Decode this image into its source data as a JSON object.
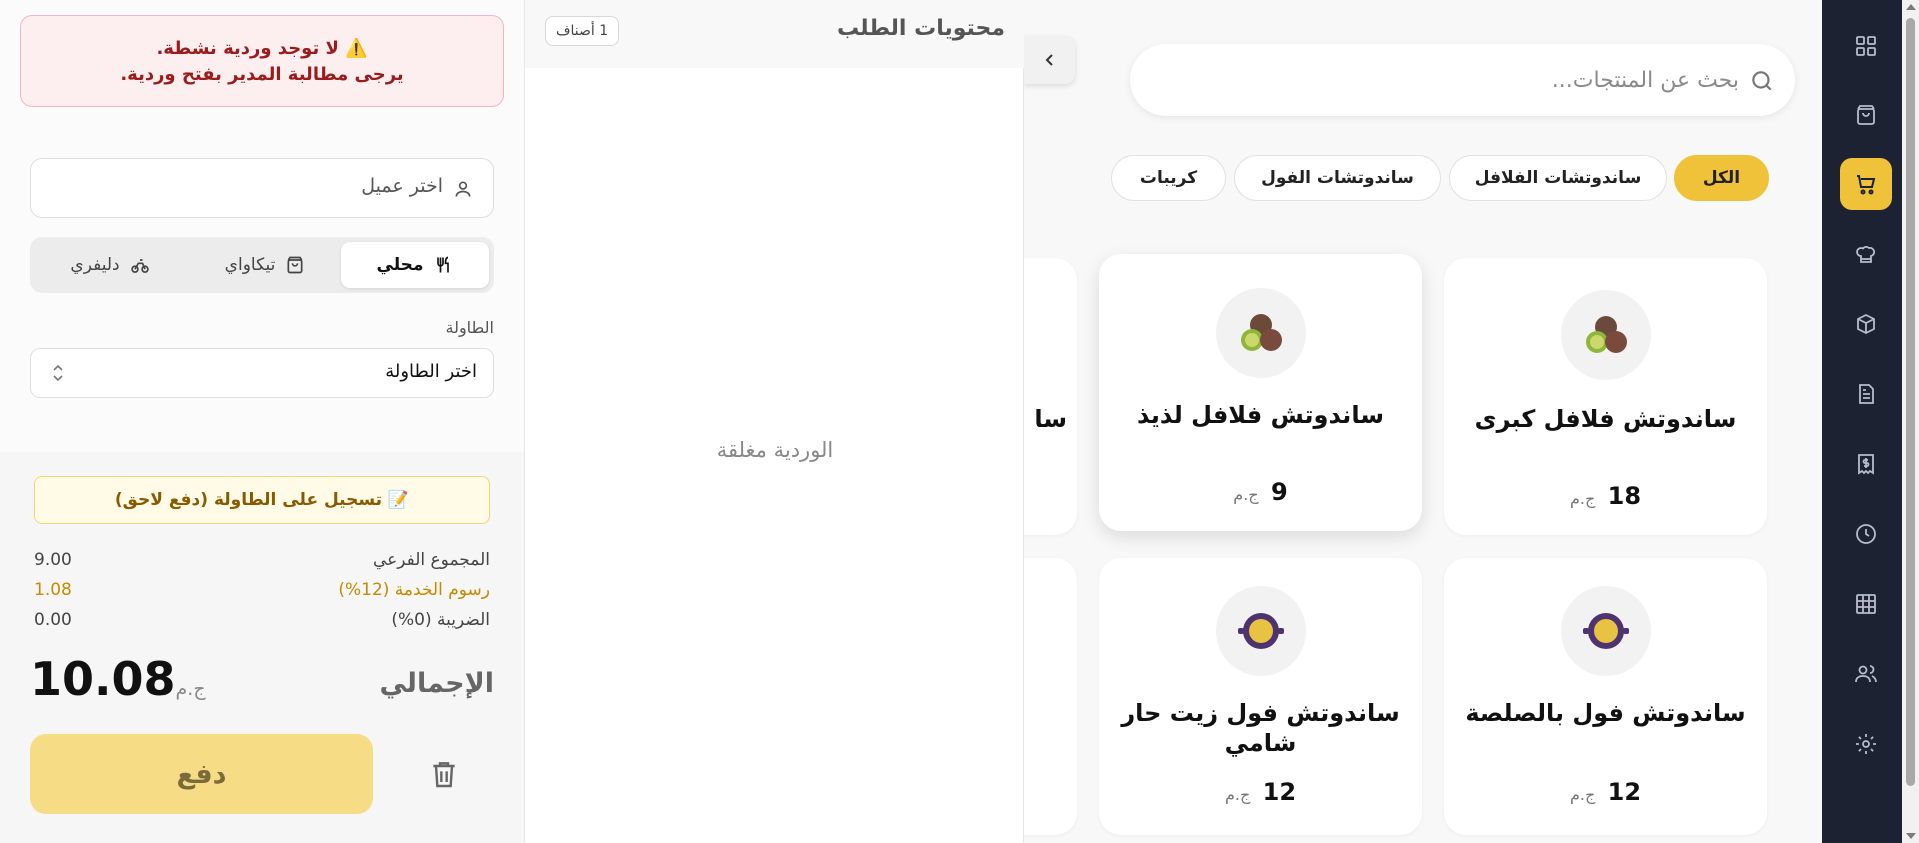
{
  "sidebar": {
    "items": [
      {
        "icon": "grid-icon",
        "active": false
      },
      {
        "icon": "bag-icon",
        "active": false
      },
      {
        "icon": "cart-icon",
        "active": true
      },
      {
        "icon": "chef-hat-icon",
        "active": false
      },
      {
        "icon": "box-icon",
        "active": false
      },
      {
        "icon": "document-icon",
        "active": false
      },
      {
        "icon": "receipt-dollar-icon",
        "active": false
      },
      {
        "icon": "clock-icon",
        "active": false
      },
      {
        "icon": "table-grid-icon",
        "active": false
      },
      {
        "icon": "users-icon",
        "active": false
      },
      {
        "icon": "settings-gear-icon",
        "active": false
      }
    ]
  },
  "search": {
    "placeholder": "بحث عن المنتجات..."
  },
  "categories": [
    {
      "label": "الكل",
      "active": true
    },
    {
      "label": "ساندوتشات الفلافل",
      "active": false
    },
    {
      "label": "ساندوتشات الفول",
      "active": false
    },
    {
      "label": "كريبات",
      "active": false
    }
  ],
  "products": [
    {
      "name": "ساندوتش فلافل كبرى",
      "price": "18",
      "currency": "ج.م",
      "image": "falafel-image"
    },
    {
      "name": "ساندوتش فلافل لذيذ",
      "price": "9",
      "currency": "ج.م",
      "image": "falafel-image"
    },
    {
      "name": "سا",
      "price": "",
      "currency": "",
      "image": ""
    },
    {
      "name": "ساندوتش فول بالصلصة",
      "price": "12",
      "currency": "ج.م",
      "image": "foul-pot-image"
    },
    {
      "name": "ساندوتش فول زيت حار شامي",
      "price": "12",
      "currency": "ج.م",
      "image": "foul-pot-image"
    }
  ],
  "order": {
    "title": "محتويات الطلب",
    "count_badge": "1 أصناف",
    "empty_message": "الوردية مغلقة"
  },
  "checkout": {
    "alert_line1": "⚠️ لا توجد وردية نشطة.",
    "alert_line2": "يرجى مطالبة المدير بفتح وردية.",
    "customer_placeholder": "اختر عميل",
    "order_types": [
      {
        "label": "محلي",
        "icon": "cutlery-icon",
        "active": true
      },
      {
        "label": "تيكاواي",
        "icon": "bag-icon",
        "active": false
      },
      {
        "label": "دليفري",
        "icon": "bike-icon",
        "active": false
      }
    ],
    "table_label": "الطاولة",
    "table_placeholder": "اختر الطاولة",
    "pay_later_label": "📝 تسجيل على الطاولة (دفع لاحق)",
    "subtotal_label": "المجموع الفرعي",
    "subtotal_value": "9.00",
    "service_label": "رسوم الخدمة (12%)",
    "service_value": "1.08",
    "tax_label": "الضريبة (0%)",
    "tax_value": "0.00",
    "total_label": "الإجمالي",
    "total_value": "10.08",
    "currency": "ج.م",
    "pay_label": "دفع"
  },
  "colors": {
    "accent": "#f0c23a",
    "rail": "#1d2232",
    "alert_text": "#9b1c1c",
    "service_fee": "#c68a00"
  }
}
